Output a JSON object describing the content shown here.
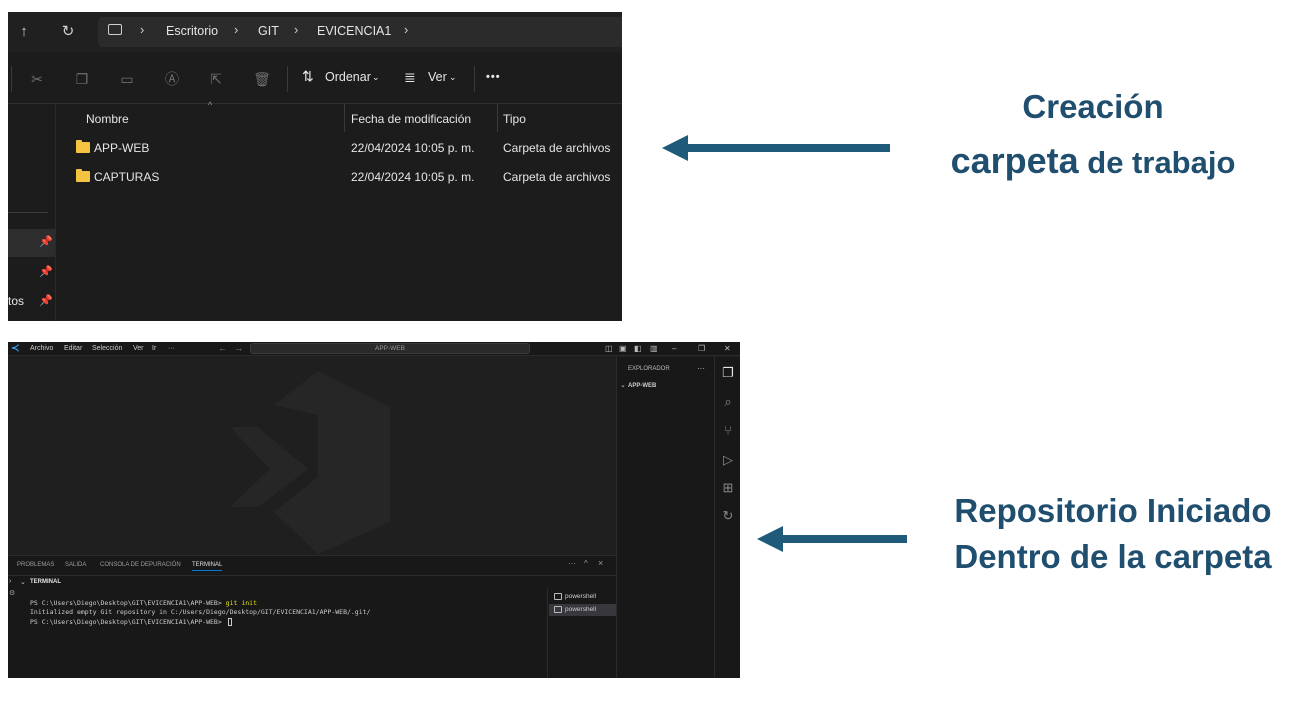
{
  "explorer": {
    "nav": {
      "up_icon": "arrow-up-icon",
      "refresh_icon": "refresh-icon",
      "pc_icon": "monitor-icon"
    },
    "breadcrumb": [
      "Escritorio",
      "GIT",
      "EVICENCIA1"
    ],
    "toolbar": {
      "icons": [
        "cut-icon",
        "copy-icon",
        "paste-icon",
        "rename-icon",
        "share-icon",
        "delete-icon"
      ],
      "sort_label": "Ordenar",
      "view_label": "Ver",
      "more_label": "•••"
    },
    "columns": {
      "name": "Nombre",
      "date": "Fecha de modificación",
      "type": "Tipo"
    },
    "files": [
      {
        "name": "APP-WEB",
        "date": "22/04/2024 10:05 p. m.",
        "type": "Carpeta de archivos"
      },
      {
        "name": "CAPTURAS",
        "date": "22/04/2024 10:05 p. m.",
        "type": "Carpeta de archivos"
      }
    ],
    "sidebar_partial_label": "tos"
  },
  "annotations": {
    "top_line1": "Creación",
    "top_line2a": "carpeta",
    "top_line2b": " de trabajo",
    "bottom_line1": "Repositorio Iniciado",
    "bottom_line2": "Dentro de la carpeta",
    "color": "#1f4e6e"
  },
  "vscode": {
    "menu": [
      "Archivo",
      "Editar",
      "Selección",
      "Ver",
      "Ir",
      "···"
    ],
    "search_text": "APP-WEB",
    "panel_tabs": [
      "PROBLEMAS",
      "SALIDA",
      "CONSOLA DE DEPURACIÓN",
      "TERMINAL"
    ],
    "panel_actions": [
      "···",
      "^",
      "×"
    ],
    "terminal_section": "TERMINAL",
    "terminal_lines": {
      "l1_prompt": "PS C:\\Users\\Diego\\Desktop\\GIT\\EVICENCIA1\\APP-WEB> ",
      "l1_cmd": "git init",
      "l2": "Initialized empty Git repository in C:/Users/Diego/Desktop/GIT/EVICENCIA1/APP-WEB/.git/",
      "l3_prompt": "PS C:\\Users\\Diego\\Desktop\\GIT\\EVICENCIA1\\APP-WEB> "
    },
    "terminals": [
      "powershell",
      "powershell"
    ],
    "explorer_title": "EXPLORADOR",
    "explorer_more": "···",
    "folder_name": "APP-WEB",
    "accent": "#0078d4"
  }
}
